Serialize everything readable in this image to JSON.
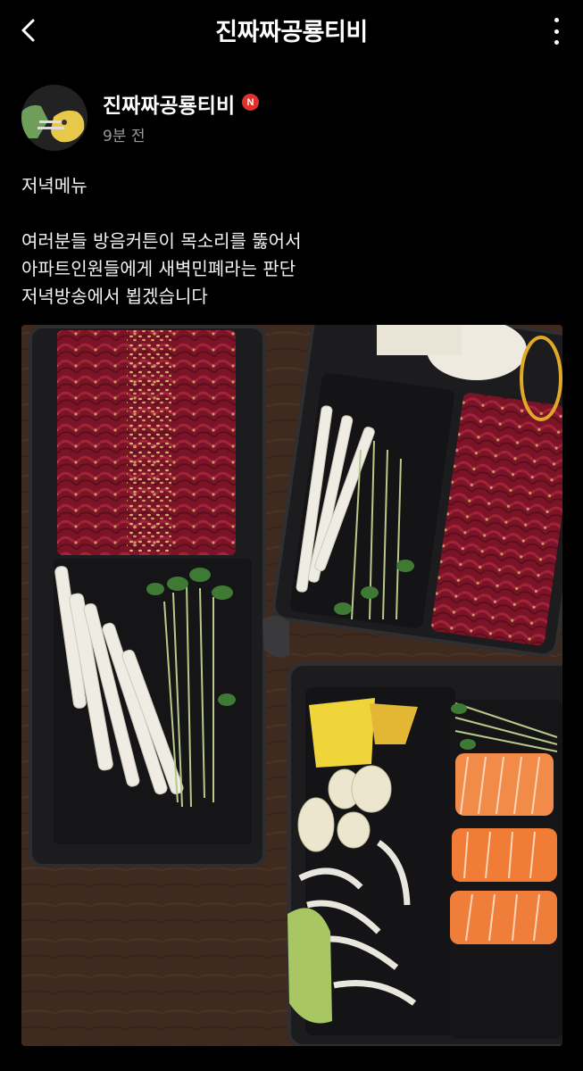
{
  "header": {
    "title": "진짜짜공룡티비"
  },
  "post": {
    "author": "진짜짜공룡티비",
    "badge": "N",
    "time": "9분 전",
    "lines": [
      "저녁메뉴",
      "여러분들 방음커튼이 목소리를 뚫어서",
      "아파트인원들에게 새벽민폐라는 판단",
      "저녁방송에서 뵙겠습니다"
    ]
  },
  "icons": {
    "back": "back-arrow-icon",
    "more": "more-vertical-icon"
  },
  "colors": {
    "background": "#000000",
    "badge": "#e0312c",
    "secondary_text": "#9a9a9a"
  }
}
